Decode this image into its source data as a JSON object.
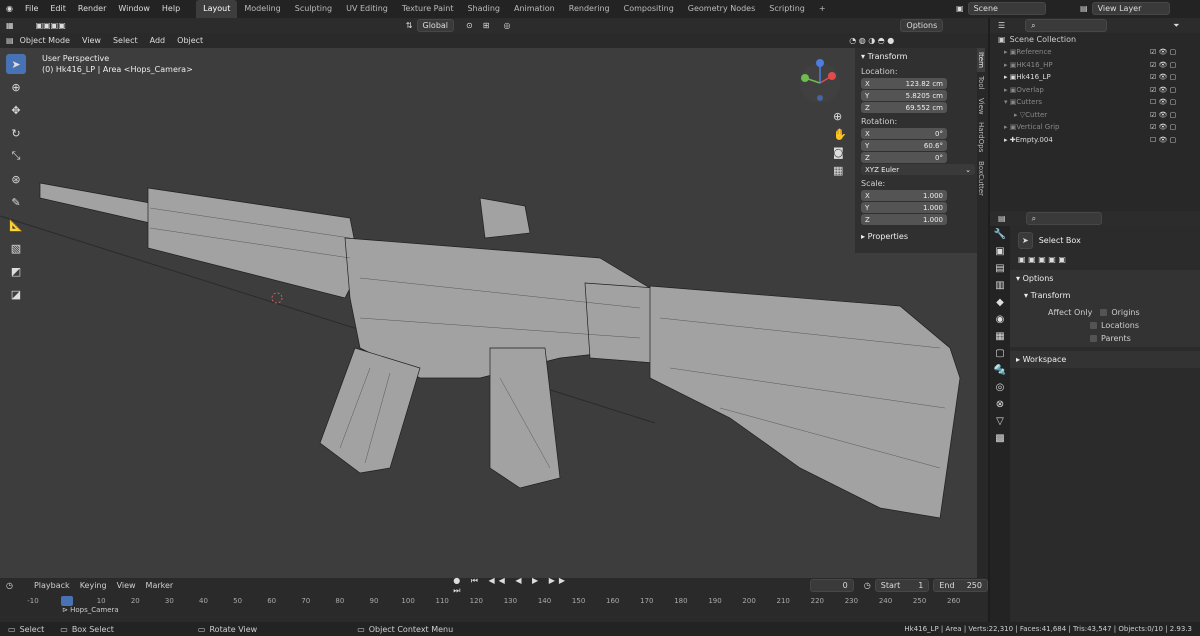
{
  "menus": [
    "File",
    "Edit",
    "Render",
    "Window",
    "Help"
  ],
  "workspaces": [
    "Layout",
    "Modeling",
    "Sculpting",
    "UV Editing",
    "Texture Paint",
    "Shading",
    "Animation",
    "Rendering",
    "Compositing",
    "Geometry Nodes",
    "Scripting"
  ],
  "active_workspace": "Layout",
  "scene_field": "Scene",
  "view_layer_field": "View Layer",
  "toolheader": {
    "orientation": "Global",
    "options": "Options"
  },
  "header3d": {
    "mode": "Object Mode",
    "menus": [
      "View",
      "Select",
      "Add",
      "Object"
    ]
  },
  "viewport": {
    "perspective": "User Perspective",
    "object_info": "(0) Hk416_LP | Area <Hops_Camera>"
  },
  "npanel": {
    "section": "Transform",
    "location_label": "Location:",
    "location": [
      {
        "axis": "X",
        "value": "123.82 cm"
      },
      {
        "axis": "Y",
        "value": "5.8205 cm"
      },
      {
        "axis": "Z",
        "value": "69.552 cm"
      }
    ],
    "rotation_label": "Rotation:",
    "rotation": [
      {
        "axis": "X",
        "value": "0°"
      },
      {
        "axis": "Y",
        "value": "60.6°"
      },
      {
        "axis": "Z",
        "value": "0°"
      }
    ],
    "rotation_mode": "XYZ Euler",
    "scale_label": "Scale:",
    "scale": [
      {
        "axis": "X",
        "value": "1.000"
      },
      {
        "axis": "Y",
        "value": "1.000"
      },
      {
        "axis": "Z",
        "value": "1.000"
      }
    ],
    "properties": "Properties",
    "tabs": [
      "Item",
      "Tool",
      "View",
      "HardOps",
      "BoxCutter"
    ]
  },
  "outliner": {
    "title": "Scene Collection",
    "items": [
      {
        "name": "Reference",
        "dim": true
      },
      {
        "name": "HK416_HP",
        "dim": true
      },
      {
        "name": "Hk416_LP",
        "dim": false
      },
      {
        "name": "Overlap",
        "dim": true
      },
      {
        "name": "Cutters",
        "dim": true
      },
      {
        "name": "Cutter",
        "dim": true
      },
      {
        "name": "Vertical Grip",
        "dim": true
      },
      {
        "name": "Empty.004",
        "dim": false
      }
    ]
  },
  "props": {
    "tool": "Select Box",
    "options": "Options",
    "transform": "Transform",
    "affect_only": "Affect Only",
    "checkboxes": [
      "Origins",
      "Locations",
      "Parents"
    ],
    "workspace": "Workspace"
  },
  "timeline": {
    "menus": [
      "Playback",
      "Keying",
      "View",
      "Marker"
    ],
    "current_frame": "0",
    "start_label": "Start",
    "start": "1",
    "end_label": "End",
    "end": "250",
    "ticks": [
      "-10",
      "0",
      "10",
      "20",
      "30",
      "40",
      "50",
      "60",
      "70",
      "80",
      "90",
      "100",
      "110",
      "120",
      "130",
      "140",
      "150",
      "160",
      "170",
      "180",
      "190",
      "200",
      "210",
      "220",
      "230",
      "240",
      "250",
      "260"
    ],
    "marker": "Hops_Camera"
  },
  "status": {
    "select": "Select",
    "box_select": "Box Select",
    "rotate_view": "Rotate View",
    "context_menu": "Object Context Menu",
    "stats": "Hk416_LP | Area | Verts:22,310 | Faces:41,684 | Tris:43,547 | Objects:0/10 | 2.93.3"
  }
}
